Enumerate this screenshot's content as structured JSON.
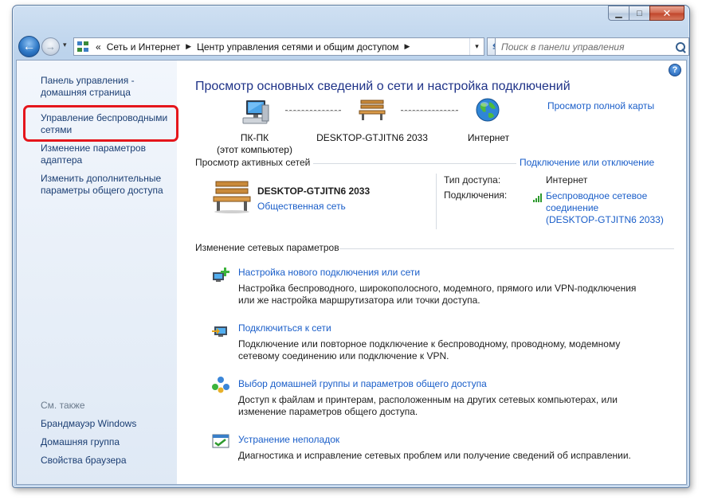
{
  "window": {
    "minimize_glyph": "▁",
    "maximize_glyph": "□",
    "close_glyph": "✕"
  },
  "navigation": {
    "back_glyph": "←",
    "forward_glyph": "→",
    "history_dropdown_glyph": "▾",
    "breadcrumb_chevron": "«",
    "breadcrumb": [
      "Сеть и Интернет",
      "Центр управления сетями и общим доступом"
    ],
    "breadcrumb_separator": "▶",
    "address_dropdown_glyph": "▾",
    "refresh_glyph": "⇆",
    "search_placeholder": "Поиск в панели управления"
  },
  "sidebar": {
    "home_link": "Панель управления - домашняя страница",
    "links": [
      "Управление беспроводными сетями",
      "Изменение параметров адаптера",
      "Изменить дополнительные параметры общего доступа"
    ],
    "see_also_label": "См. также",
    "see_also": [
      "Брандмауэр Windows",
      "Домашняя группа",
      "Свойства браузера"
    ]
  },
  "help_glyph": "?",
  "main": {
    "title": "Просмотр основных сведений о сети и настройка подключений",
    "full_map_link": "Просмотр полной карты",
    "network_map": {
      "computer_name": "ПК-ПК",
      "computer_sub": "(этот компьютер)",
      "network_name": "DESKTOP-GTJITN6 2033",
      "internet_label": "Интернет"
    },
    "active_networks": {
      "section_title": "Просмотр активных сетей",
      "connect_link": "Подключение или отключение",
      "network_name": "DESKTOP-GTJITN6 2033",
      "network_type": "Общественная сеть",
      "access_type_label": "Тип доступа:",
      "access_type_value": "Интернет",
      "connections_label": "Подключения:",
      "connection_line1": "Беспроводное сетевое",
      "connection_line2": "соединение",
      "connection_line3": "(DESKTOP-GTJITN6 2033)"
    },
    "change_settings": {
      "section_title": "Изменение сетевых параметров",
      "tasks": [
        {
          "title": "Настройка нового подключения или сети",
          "desc1": "Настройка беспроводного, широкополосного, модемного, прямого или VPN-подключения",
          "desc2": "или же настройка маршрутизатора или точки доступа."
        },
        {
          "title": "Подключиться к сети",
          "desc1": "Подключение или повторное подключение к беспроводному, проводному, модемному",
          "desc2": "сетевому соединению или подключение к VPN."
        },
        {
          "title": "Выбор домашней группы и параметров общего доступа",
          "desc1": "Доступ к файлам и принтерам, расположенным на других сетевых компьютерах, или",
          "desc2": "изменение параметров общего доступа."
        },
        {
          "title": "Устранение неполадок",
          "desc1": "Диагностика и исправление сетевых проблем или получение сведений об исправлении.",
          "desc2": ""
        }
      ]
    }
  },
  "colors": {
    "link": "#1a5ec9",
    "sidebar_link": "#1b3e73",
    "title": "#1e3287",
    "highlight": "#e5161c"
  }
}
